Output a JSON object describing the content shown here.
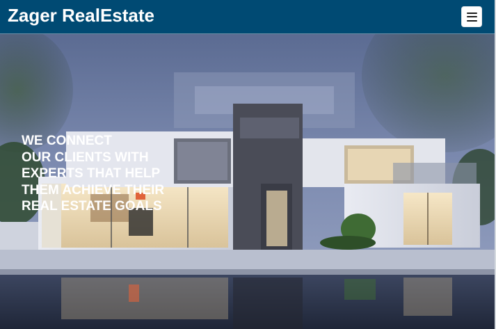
{
  "navbar": {
    "brand": "Zager RealEstate",
    "menu_icon": "hamburger-menu-icon",
    "background_color": "#004a73"
  },
  "hero": {
    "headline_lines": [
      "WE CONNECT",
      "OUR CLIENTS WITH",
      "EXPERTS THAT HELP",
      "THEM ACHIEVE THEIR",
      "REAL ESTATE GOALS"
    ],
    "image": "modern-house-at-dusk-with-pool"
  }
}
